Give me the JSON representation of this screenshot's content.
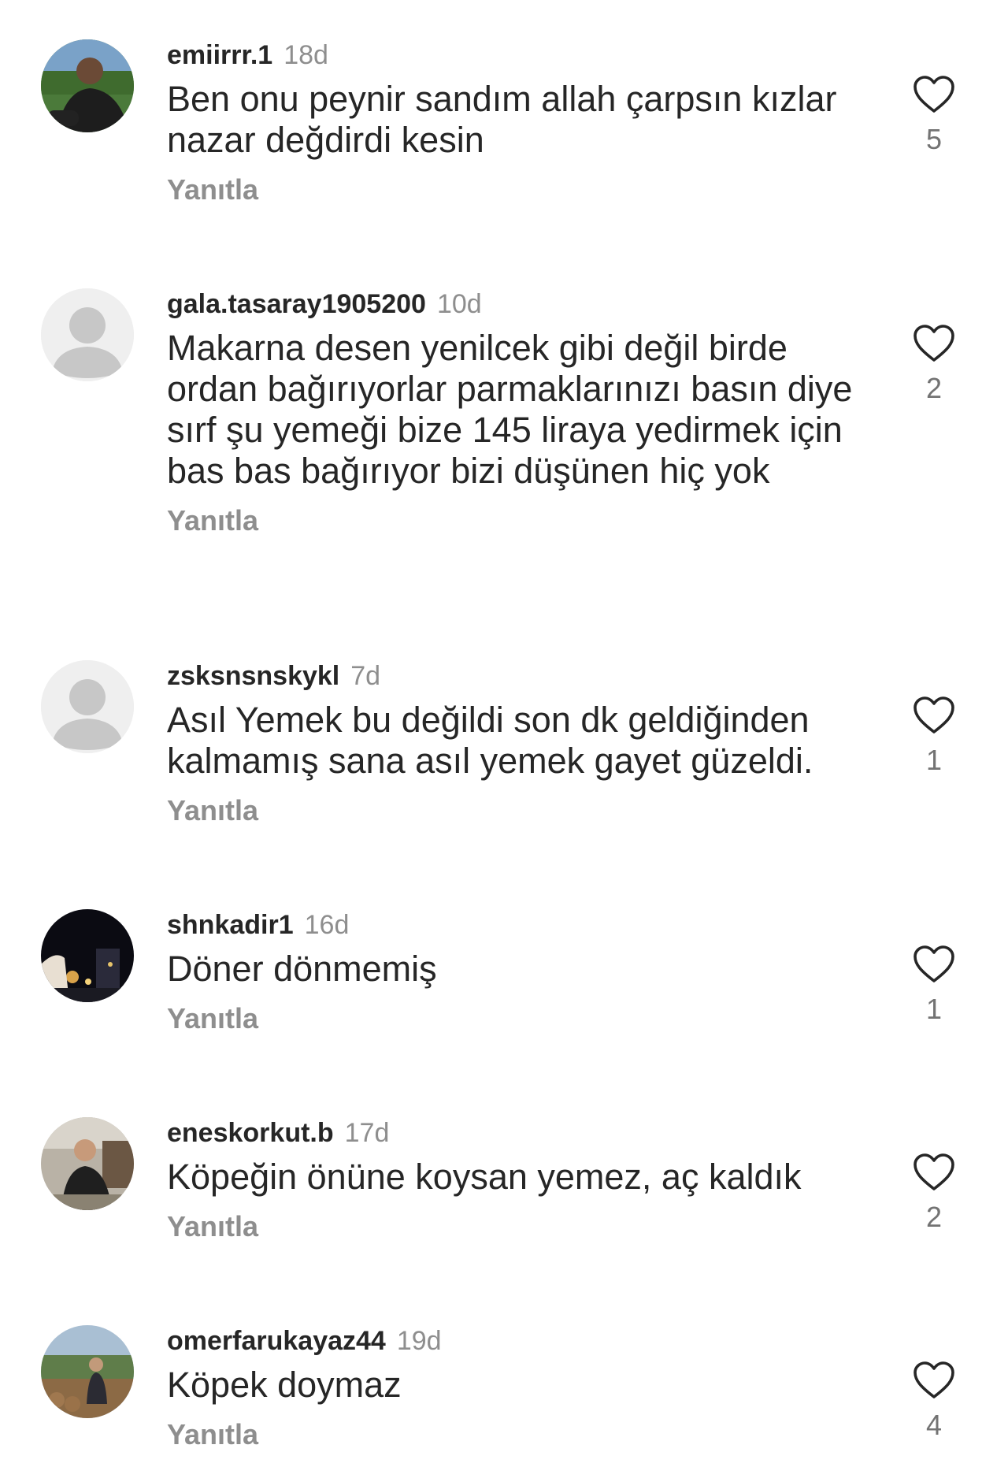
{
  "comments": [
    {
      "username": "emiirrr.1",
      "time": "18d",
      "text": "Ben onu peynir sandım allah çarpsın kızlar nazar değdirdi kesin",
      "reply_label": "Yanıtla",
      "likes": "5",
      "avatar": "photo"
    },
    {
      "username": "gala.tasaray1905200",
      "time": "10d",
      "text": "Makarna desen yenilcek gibi değil birde ordan bağırıyorlar  parmaklarınızı basın diye sırf şu yemeği bize 145 liraya yedirmek için bas bas bağırıyor bizi düşünen hiç yok",
      "reply_label": "Yanıtla",
      "likes": "2",
      "avatar": "default-person-icon"
    },
    {
      "username": "zsksnsnskykl",
      "time": "7d",
      "text": "Asıl Yemek bu değildi son dk geldiğinden kalmamış sana asıl yemek gayet güzeldi.",
      "reply_label": "Yanıtla",
      "likes": "1",
      "avatar": "default-person-icon"
    },
    {
      "username": "shnkadir1",
      "time": "16d",
      "text": "Döner dönmemiş",
      "reply_label": "Yanıtla",
      "likes": "1",
      "avatar": "photo"
    },
    {
      "username": "eneskorkut.b",
      "time": "17d",
      "text": "Köpeğin önüne koysan yemez, aç kaldık",
      "reply_label": "Yanıtla",
      "likes": "2",
      "avatar": "photo"
    },
    {
      "username": "omerfarukayaz44",
      "time": "19d",
      "text": "Köpek doymaz",
      "reply_label": "Yanıtla",
      "likes": "4",
      "avatar": "photo"
    }
  ],
  "icons": {
    "like": "heart-outline-icon",
    "default_avatar": "person-silhouette-icon"
  },
  "colors": {
    "username": "#262626",
    "secondary_text": "#8e8e8e",
    "placeholder_avatar_bg": "#efefef",
    "placeholder_avatar_fg": "#c7c7c7"
  }
}
